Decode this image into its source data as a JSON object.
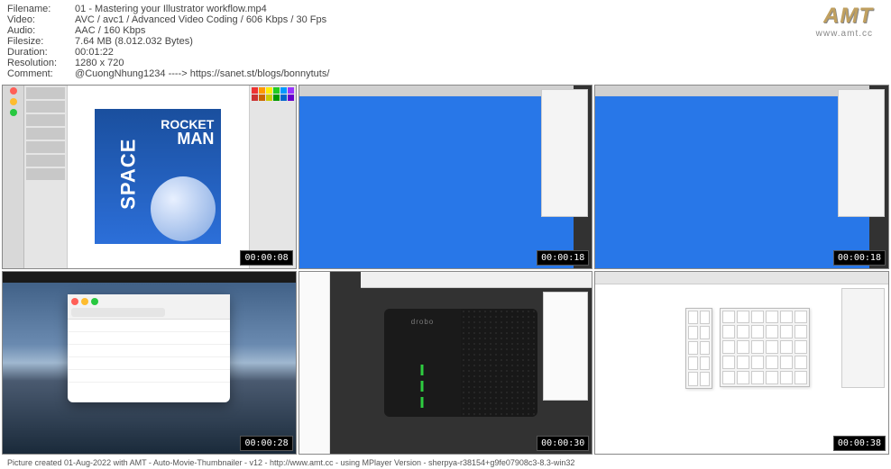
{
  "info": {
    "filename_label": "Filename:",
    "filename": "01 - Mastering your Illustrator workflow.mp4",
    "video_label": "Video:",
    "video": "AVC / avc1 / Advanced Video Coding / 606 Kbps / 30 Fps",
    "audio_label": "Audio:",
    "audio": "AAC / 160 Kbps",
    "filesize_label": "Filesize:",
    "filesize": "7.64 MB (8.012.032 Bytes)",
    "duration_label": "Duration:",
    "duration": "00:01:22",
    "resolution_label": "Resolution:",
    "resolution": "1280 x 720",
    "comment_label": "Comment:",
    "comment": "@CuongNhung1234 ----> https://sanet.st/blogs/bonnytuts/"
  },
  "logo": {
    "main": "AMT",
    "sub": "www.amt.cc"
  },
  "thumbs": [
    {
      "timestamp": "00:00:08",
      "art_title1": "ROCKET",
      "art_title2": "MAN",
      "art_side": "SPACE"
    },
    {
      "timestamp": "00:00:18"
    },
    {
      "timestamp": "00:00:18"
    },
    {
      "timestamp": "00:00:28"
    },
    {
      "timestamp": "00:00:30",
      "device": "drobo"
    },
    {
      "timestamp": "00:00:38"
    }
  ],
  "footer": "Picture created 01-Aug-2022 with AMT - Auto-Movie-Thumbnailer - v12 - http://www.amt.cc - using MPlayer Version - sherpya-r38154+g9fe07908c3-8.3-win32"
}
